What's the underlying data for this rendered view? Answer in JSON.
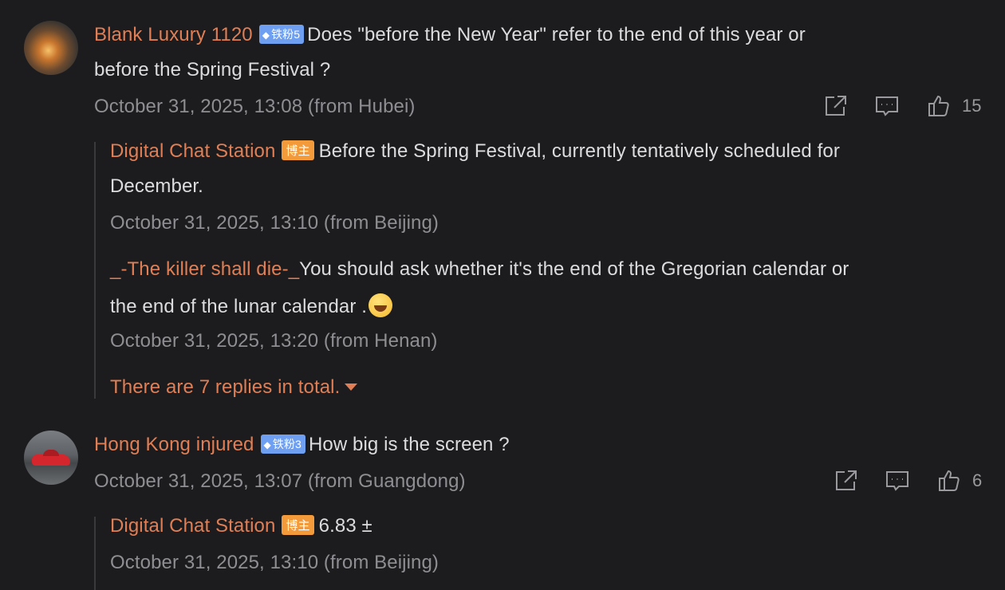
{
  "comments": [
    {
      "user": "Blank Luxury 1120",
      "badge": "铁粉5",
      "text_line1": "Does \"before the New Year\" refer to the end of this year or",
      "text_line2": "before the Spring Festival ?",
      "meta": "October 31, 2025, 13:08 (from Hubei)",
      "likes": "15",
      "replies": [
        {
          "user": "Digital Chat Station",
          "badge": "博主",
          "text_line1": "Before the Spring Festival, currently tentatively scheduled for",
          "text_line2": "December.",
          "meta": "October 31, 2025, 13:10 (from Beijing)"
        },
        {
          "user": "_-The killer shall die-_",
          "text_line1": "You should ask whether it's the end of the Gregorian calendar or",
          "text_line2": "the end of the lunar calendar .",
          "meta": "October 31, 2025, 13:20 (from Henan)"
        }
      ],
      "more_replies": "There are 7 replies in total."
    },
    {
      "user": "Hong Kong injured",
      "badge": "铁粉3",
      "text_line1": "How big is the screen ?",
      "meta": "October 31, 2025, 13:07 (from Guangdong)",
      "likes": "6",
      "replies": [
        {
          "user": "Digital Chat Station",
          "badge": "博主",
          "text_line1": "6.83 ±",
          "meta": "October 31, 2025, 13:10 (from Beijing)"
        }
      ]
    }
  ],
  "icons": {
    "share": "share-icon",
    "reply": "comment-icon",
    "like": "thumbs-up-icon",
    "gem": "diamond-icon",
    "emoji": "laughing-crying-emoji"
  },
  "colors": {
    "background": "#1c1c1e",
    "username": "#e07f55",
    "text": "#dcdcde",
    "meta": "#8e8e93",
    "fan_badge": "#6f9ff0",
    "host_badge": "#f39b3a"
  }
}
